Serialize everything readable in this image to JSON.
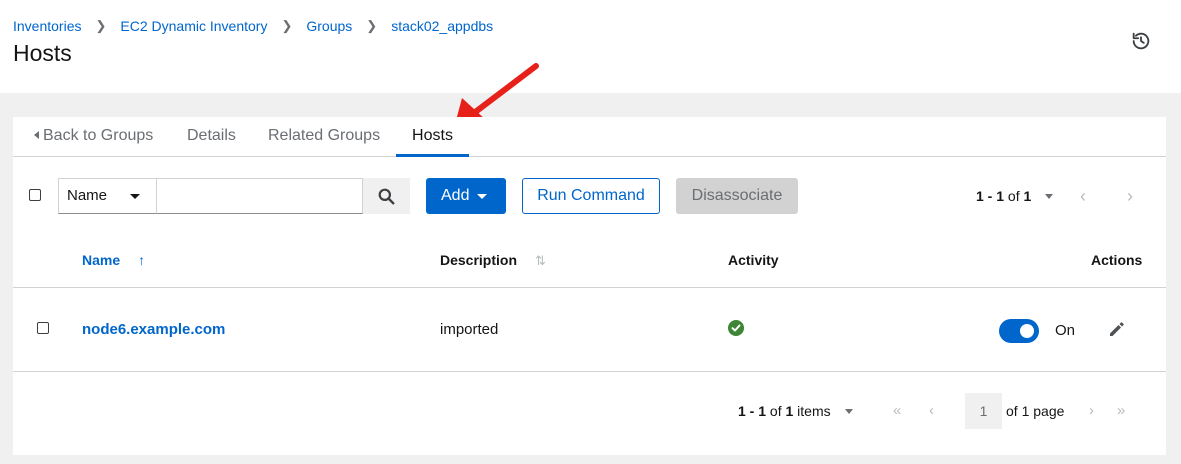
{
  "breadcrumb": [
    {
      "label": "Inventories"
    },
    {
      "label": "EC2 Dynamic Inventory"
    },
    {
      "label": "Groups"
    },
    {
      "label": "stack02_appdbs"
    }
  ],
  "page_title": "Hosts",
  "tabs": [
    {
      "label": "Back to Groups"
    },
    {
      "label": "Details"
    },
    {
      "label": "Related Groups"
    },
    {
      "label": "Hosts",
      "active": true
    }
  ],
  "toolbar": {
    "filter_label": "Name",
    "search_value": "",
    "add_label": "Add",
    "run_command_label": "Run Command",
    "disassociate_label": "Disassociate",
    "pagination_range": "1 - 1",
    "pagination_of": "of",
    "pagination_total": "1"
  },
  "table": {
    "columns": {
      "name": "Name",
      "description": "Description",
      "activity": "Activity",
      "actions": "Actions"
    },
    "rows": [
      {
        "name": "node6.example.com",
        "description": "imported",
        "activity": "success",
        "toggle_label": "On",
        "toggle_on": true
      }
    ]
  },
  "pagination_bottom": {
    "range": "1 - 1",
    "of_items": "of",
    "total": "1",
    "items_suffix": "items",
    "current_page": "1",
    "of_pages": "of 1 page"
  },
  "colors": {
    "primary": "#0066cc",
    "success": "#3e8635",
    "annotation_arrow": "#e8201a"
  }
}
